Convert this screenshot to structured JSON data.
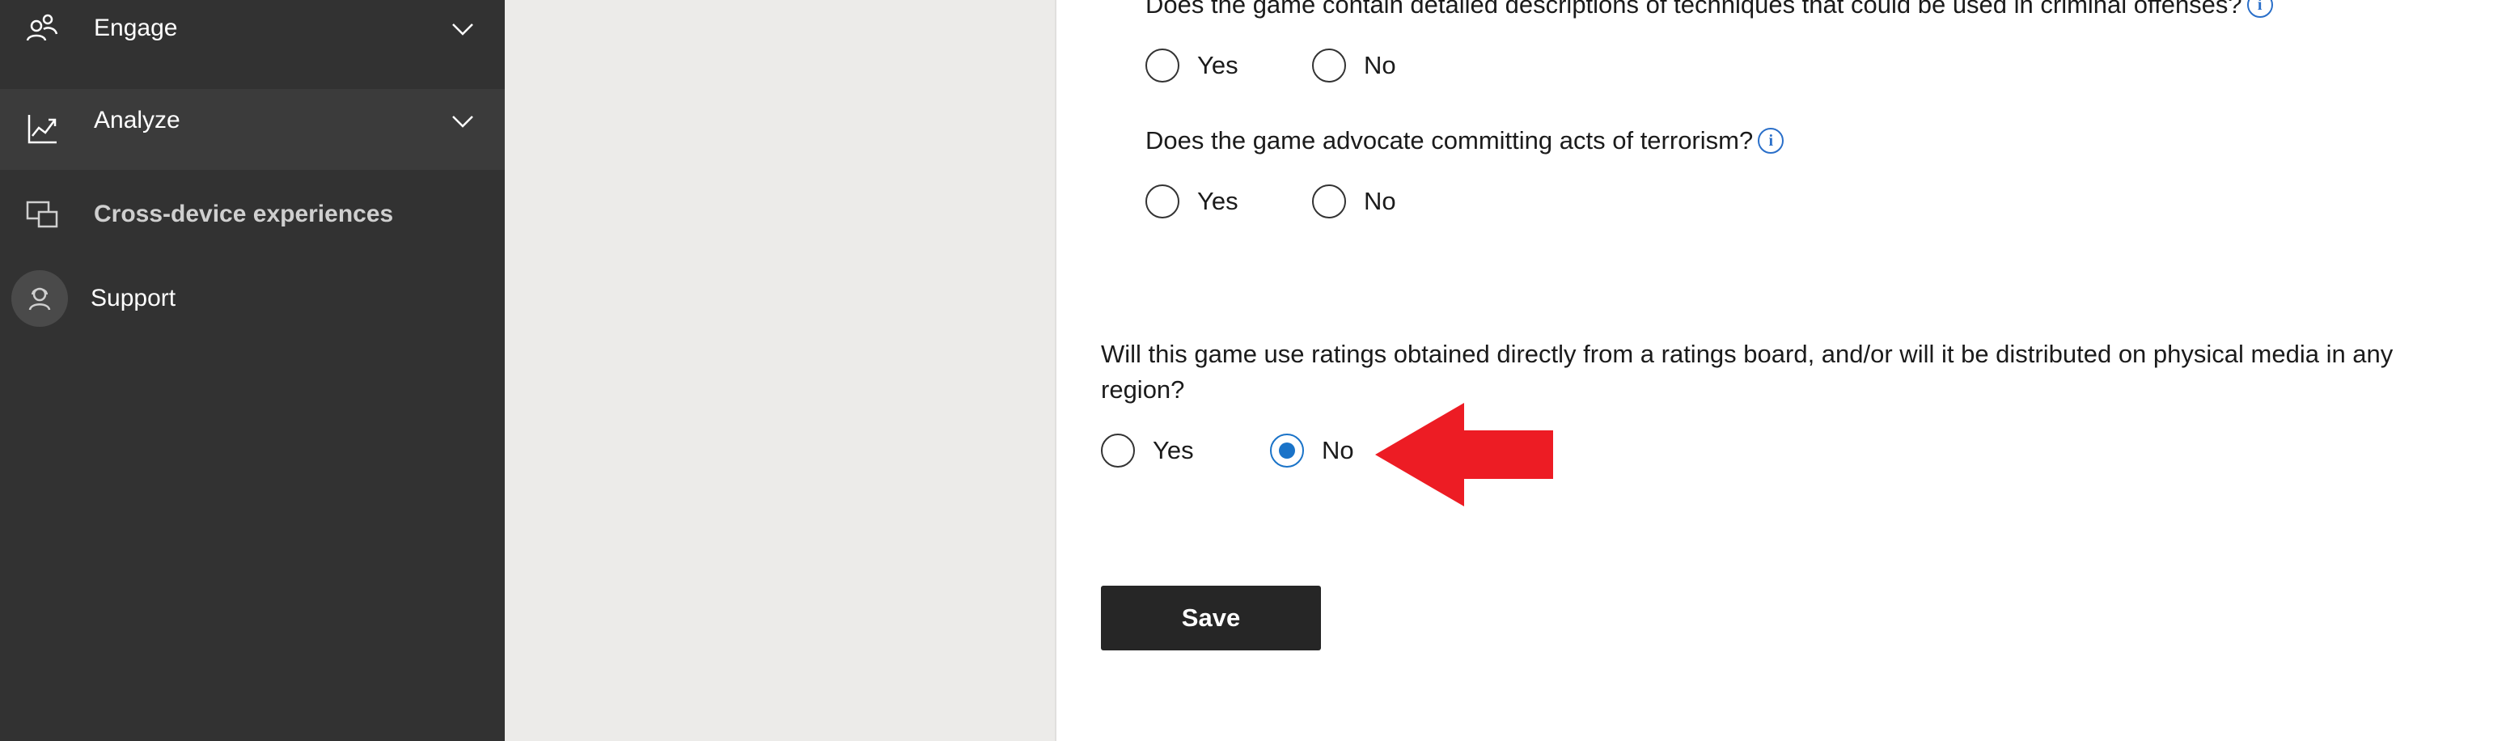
{
  "sidebar": {
    "items": [
      {
        "label": "Engage",
        "icon": "people-icon",
        "expandable": true
      },
      {
        "label": "Analyze",
        "icon": "line-chart-icon",
        "expandable": true
      },
      {
        "label": "Cross-device experiences",
        "icon": "devices-icon",
        "expandable": false
      },
      {
        "label": "Support",
        "icon": "support-person-icon",
        "expandable": false
      }
    ]
  },
  "questions": [
    {
      "text": "Does the game contain detailed descriptions of techniques that could be used in criminal offenses?",
      "has_info": true,
      "options": [
        "Yes",
        "No"
      ],
      "selected": null
    },
    {
      "text": "Does the game advocate committing acts of terrorism?",
      "has_info": true,
      "options": [
        "Yes",
        "No"
      ],
      "selected": null
    },
    {
      "text": "Will this game use ratings obtained directly from a ratings board, and/or will it be distributed on physical media in any region?",
      "has_info": false,
      "options": [
        "Yes",
        "No"
      ],
      "selected": "No"
    }
  ],
  "actions": {
    "save_label": "Save"
  },
  "colors": {
    "sidebar_bg": "#323232",
    "accent": "#1a73c8",
    "annotation_arrow": "#ed1c24",
    "button_bg": "#262626"
  }
}
